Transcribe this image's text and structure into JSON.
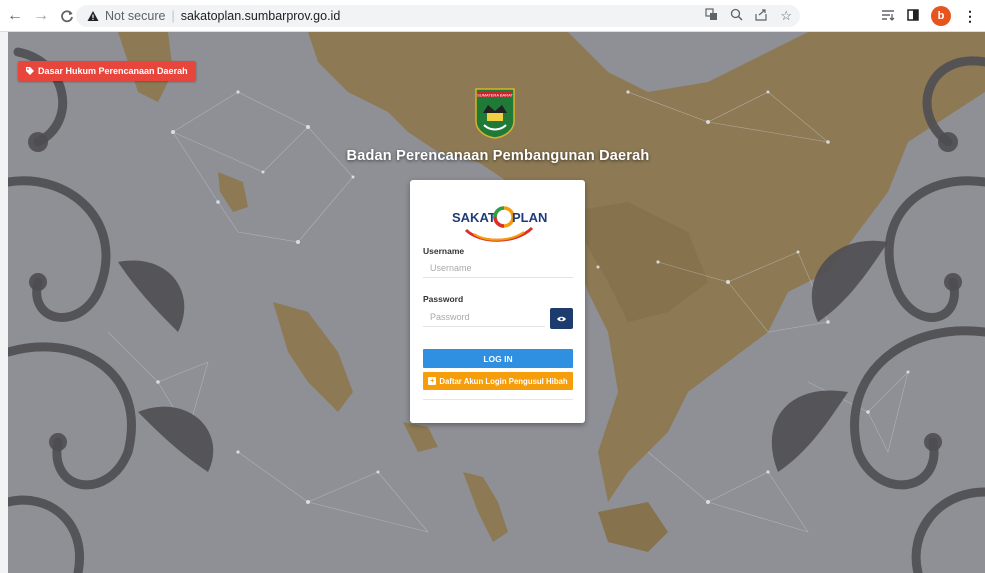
{
  "browser": {
    "security_label": "Not secure",
    "url": "sakatoplan.sumbarprov.go.id",
    "profile_initial": "b",
    "icons": [
      "back-icon",
      "forward-icon",
      "reload-icon",
      "warning-icon",
      "translate-icon",
      "zoom-icon",
      "share-icon",
      "bookmark-star-icon",
      "tab-search-icon",
      "side-panel-icon",
      "menu-icon"
    ]
  },
  "header": {
    "legal_button": "Dasar Hukum Perencanaan Daerah",
    "crest_text": "SUMATERA BARAT",
    "title": "Badan Perencanaan Pembangunan Daerah"
  },
  "login": {
    "logo_left": "SAKAT",
    "logo_right": "PLAN",
    "username_label": "Username",
    "username_placeholder": "Username",
    "password_label": "Password",
    "password_placeholder": "Password",
    "login_button": "LOG IN",
    "register_button": "Daftar Akun Login Pengusul Hibah"
  },
  "colors": {
    "legal_red": "#e8453c",
    "login_blue": "#2f8fe0",
    "register_orange": "#f59d0a",
    "eye_navy": "#1c3b6e",
    "land_gold": "#8d7a55"
  }
}
